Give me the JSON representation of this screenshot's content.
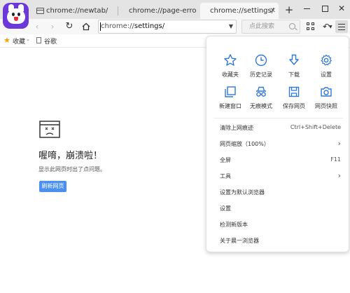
{
  "tabs": [
    {
      "label": "chrome://newtab/"
    },
    {
      "label": "chrome://page-error"
    },
    {
      "label": "chrome://settings/"
    }
  ],
  "new_tab_symbol": "+",
  "window_controls": {
    "close_symbol": "✕"
  },
  "toolbar": {
    "back_symbol": "‹",
    "forward_symbol": "›",
    "reload_symbol": "↻",
    "address_prefix": "chrome://",
    "address_path": "settings/",
    "search_placeholder": "点此搜索",
    "undo_symbol": "↶"
  },
  "bookmarks": {
    "favorites_label": "收藏",
    "google_label": "谷歌"
  },
  "crash_page": {
    "title": "喔唷，崩溃啦！",
    "description": "显示此网页时出了点问题。",
    "reload_button": "刷新网页"
  },
  "menu": {
    "grid": [
      {
        "label": "收藏夹",
        "icon": "star-outline-icon"
      },
      {
        "label": "历史记录",
        "icon": "clock-icon"
      },
      {
        "label": "下载",
        "icon": "download-icon"
      },
      {
        "label": "设置",
        "icon": "gear-icon"
      },
      {
        "label": "新建窗口",
        "icon": "new-window-icon"
      },
      {
        "label": "无痕模式",
        "icon": "incognito-icon"
      },
      {
        "label": "保存网页",
        "icon": "save-icon"
      },
      {
        "label": "网页快照",
        "icon": "camera-icon"
      }
    ],
    "items": [
      {
        "label": "清除上网痕迹",
        "shortcut": "Ctrl+Shift+Delete"
      },
      {
        "label": "网页缩放（100%）",
        "arrow": "›"
      },
      {
        "label": "全屏",
        "shortcut": "F11"
      },
      {
        "label": "工具",
        "arrow": "›"
      },
      {
        "label": "设置为默认浏览器"
      },
      {
        "label": "设置"
      },
      {
        "label": "检测新版本"
      },
      {
        "label": "关于晨一浏览器"
      }
    ]
  },
  "colors": {
    "accent_blue": "#2f78d6",
    "logo_purple": "#6b39d9",
    "reload_button_bg": "#4a90f0",
    "favorites_star": "#f4a300"
  }
}
